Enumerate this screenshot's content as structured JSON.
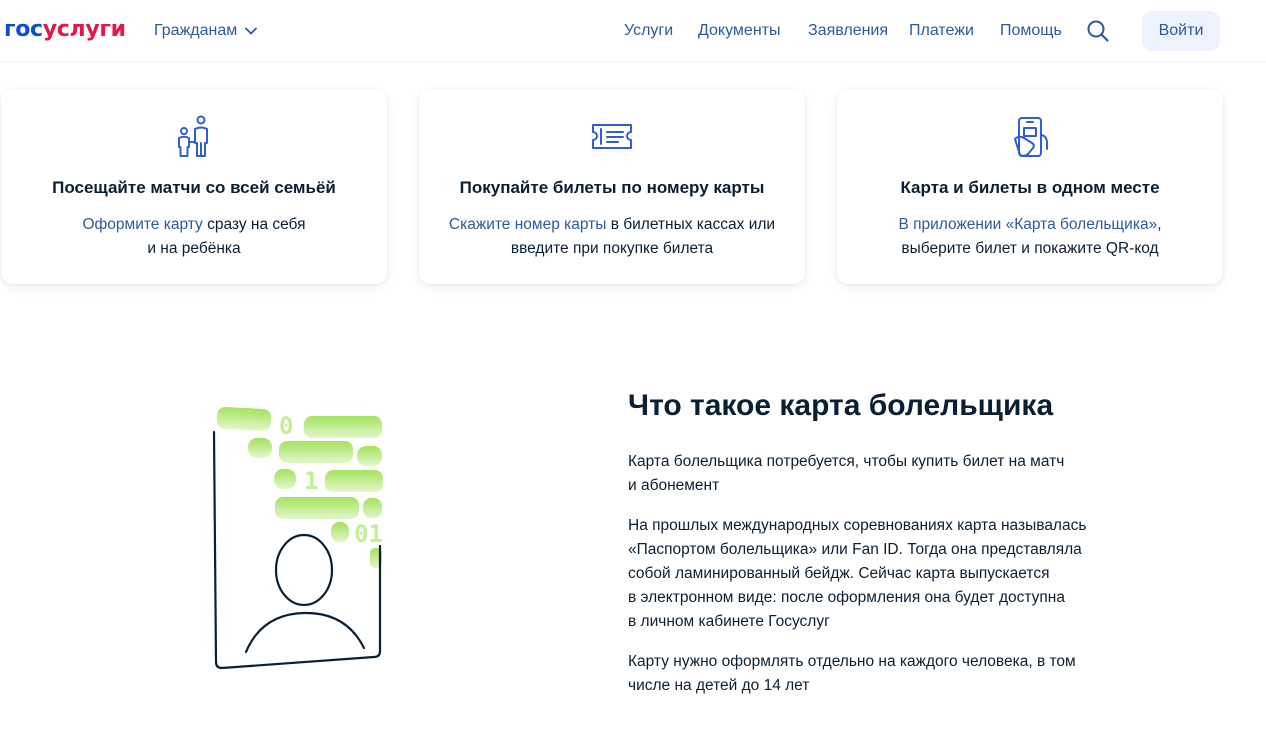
{
  "header": {
    "logo_part1": "гос",
    "logo_part2": "услуги",
    "audience": "Гражданам",
    "nav": [
      "Услуги",
      "Документы",
      "Заявления",
      "Платежи",
      "Помощь"
    ],
    "login": "Войти"
  },
  "cards": [
    {
      "icon": "family-icon",
      "title": "Посещайте матчи со всей семьёй",
      "link": "Оформите карту",
      "text_after": " сразу на себя",
      "line2": "и на ребёнка"
    },
    {
      "icon": "ticket-card-icon",
      "title": "Покупайте билеты по номеру карты",
      "link": "Скажите номер карты",
      "text_after": " в билетных кассах или",
      "line2": "введите при покупке билета"
    },
    {
      "icon": "phone-app-icon",
      "title": "Карта и билеты в одном месте",
      "link": "В приложении «Карта болельщика»",
      "text_after": ",",
      "line2": "выберите билет и покажите QR-код"
    }
  ],
  "info": {
    "title": "Что такое карта болельщика",
    "p1_lines": [
      "Карта болельщика потребуется, чтобы купить билет на матч",
      "и абонемент"
    ],
    "p2_lines": [
      "На прошлых международных соревнованиях карта называлась",
      "«Паспортом болельщика» или Fan ID. Тогда она представляла",
      "собой ламинированный бейдж. Сейчас карта выпускается",
      "в электронном виде: после оформления она будет доступна",
      "в личном кабинете Госуслуг"
    ],
    "p3_lines": [
      "Карту нужно оформлять отдельно на каждого человека, в том",
      "числе на детей до 14 лет"
    ],
    "illustration_digits": [
      "0",
      "1",
      "01"
    ]
  },
  "colors": {
    "brand_blue": "#0d4cd3",
    "brand_red": "#e3174b",
    "link": "#2d5a9b",
    "text": "#0b1f33",
    "login_bg": "#edf2fe",
    "green": "#a4e25d"
  }
}
